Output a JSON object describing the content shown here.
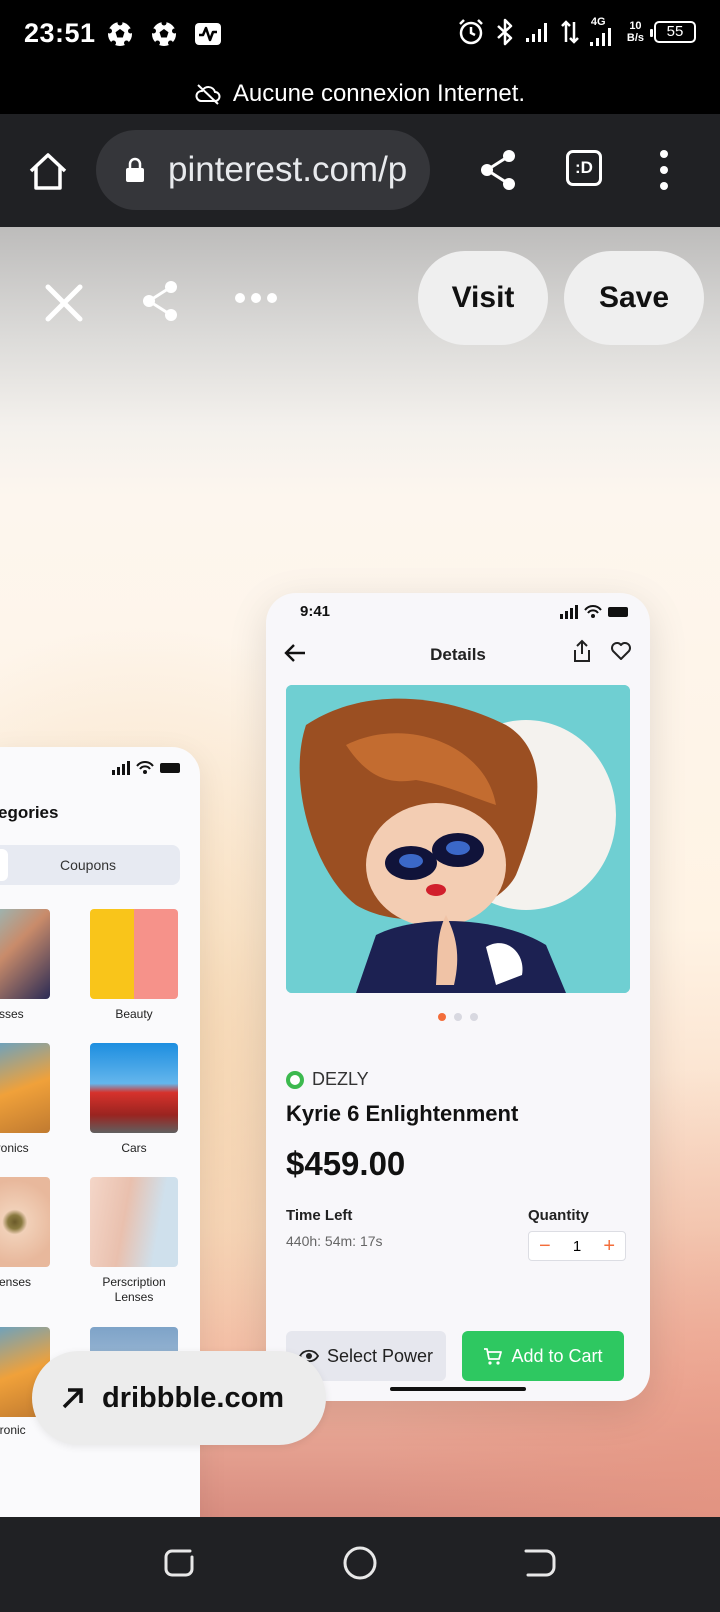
{
  "status_bar": {
    "time": "23:51",
    "left_icons": [
      "soccer-ball-icon",
      "soccer-ball-icon",
      "activity-monitor-icon"
    ],
    "right_icons": [
      "alarm-icon",
      "bluetooth-icon",
      "signal-icon",
      "data-arrows-icon",
      "signal-4g-icon"
    ],
    "network": "4G",
    "speed_value": "10",
    "speed_unit": "B/s",
    "battery": "55"
  },
  "offline_banner": {
    "icon": "cloud-off-icon",
    "text": "Aucune connexion Internet."
  },
  "browser": {
    "url": "pinterest.com/p",
    "tab_label": ":D"
  },
  "pin": {
    "visit_label": "Visit",
    "save_label": "Save",
    "source": "dribbble.com"
  },
  "mockup_left": {
    "title": "egories",
    "tab_coupons": "Coupons",
    "tiles": [
      {
        "label": "asses"
      },
      {
        "label": "Beauty"
      },
      {
        "label": "ctronics"
      },
      {
        "label": "Cars"
      },
      {
        "label": "r Lenses"
      },
      {
        "label": "Perscription Lenses"
      },
      {
        "label": "ctronic"
      },
      {
        "label": ""
      }
    ]
  },
  "mockup_right": {
    "time": "9:41",
    "title": "Details",
    "brand": "DEZLY",
    "product_name": "Kyrie 6 Enlightenment",
    "price": "$459.00",
    "time_left_label": "Time Left",
    "time_left_value": "440h: 54m: 17s",
    "quantity_label": "Quantity",
    "quantity_value": "1",
    "select_power_label": "Select Power",
    "add_to_cart_label": "Add to Cart",
    "carousel_dots": 3,
    "carousel_active": 0,
    "accent_color": "#f36d3a",
    "cart_color": "#2ec861"
  }
}
